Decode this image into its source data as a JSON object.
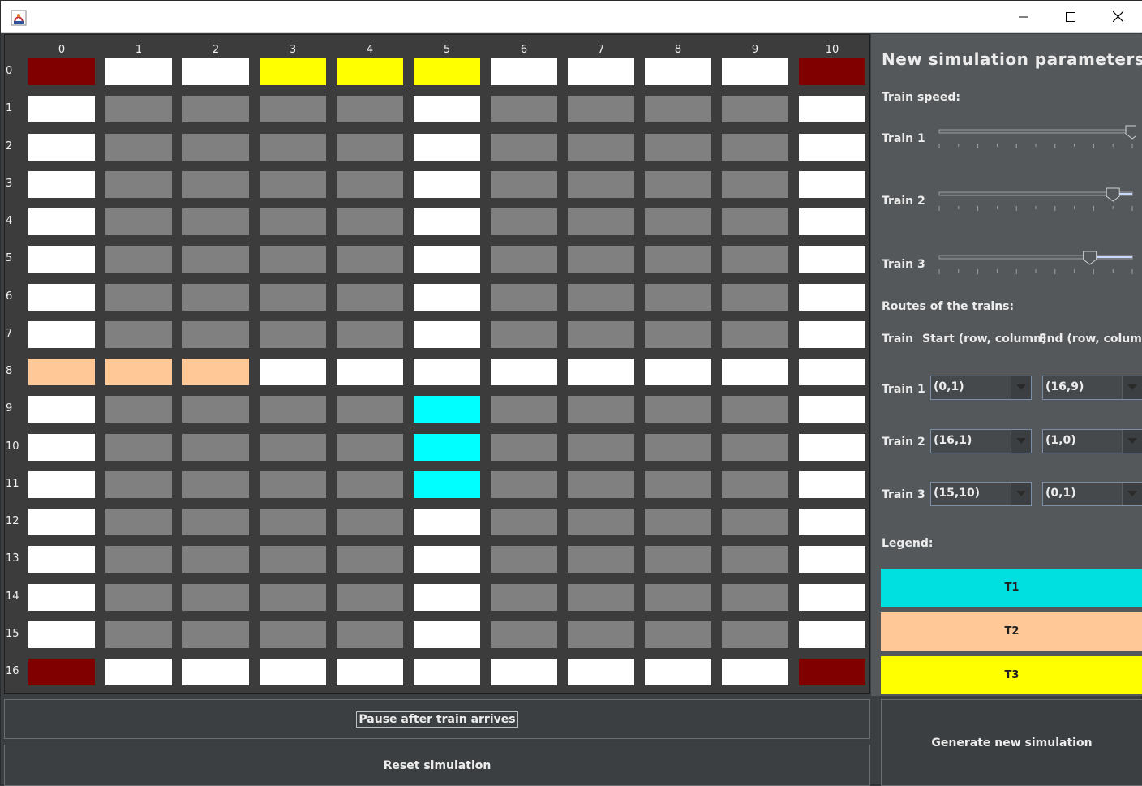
{
  "window": {
    "title": "",
    "controls": [
      "minimize",
      "maximize",
      "close"
    ]
  },
  "grid": {
    "columns": [
      "0",
      "1",
      "2",
      "3",
      "4",
      "5",
      "6",
      "7",
      "8",
      "9",
      "10"
    ],
    "rows": [
      "0",
      "1",
      "2",
      "3",
      "4",
      "5",
      "6",
      "7",
      "8",
      "9",
      "10",
      "11",
      "12",
      "13",
      "14",
      "15",
      "16"
    ],
    "cell_states_legend": {
      "W": "track",
      "G": "empty",
      "R": "station",
      "Y": "train-3",
      "O": "train-2",
      "C": "train-1"
    },
    "cells": [
      "RWWYYYWWWWR",
      "WGGGGWGGGGW",
      "WGGGGWGGGGW",
      "WGGGGWGGGGW",
      "WGGGGWGGGGW",
      "WGGGGWGGGGW",
      "WGGGGWGGGGW",
      "WGGGGWGGGGW",
      "OOOWWWWWWWW",
      "WGGGGCGGGGW",
      "WGGGGCGGGGW",
      "WGGGGCGGGGW",
      "WGGGGWGGGGW",
      "WGGGGWGGGGW",
      "WGGGGWGGGGW",
      "WGGGGWGGGGW",
      "RWWWWWWWWWR"
    ],
    "colors": {
      "W": "#ffffff",
      "G": "#808080",
      "R": "#800000",
      "Y": "#ffff00",
      "O": "#ffc896",
      "C": "#00ffff"
    }
  },
  "side": {
    "title": "New simulation parameters",
    "speed_label": "Train speed:",
    "speeds": [
      {
        "label": "Train 1",
        "value": 1.0
      },
      {
        "label": "Train 2",
        "value": 0.9
      },
      {
        "label": "Train 3",
        "value": 0.78
      }
    ],
    "routes_label": "Routes of the trains:",
    "routes_header": {
      "train": "Train",
      "start": "Start (row, column)",
      "end": "End (row, column)"
    },
    "routes": [
      {
        "label": "Train 1",
        "start": "(0,1)",
        "end": "(16,9)"
      },
      {
        "label": "Train 2",
        "start": "(16,1)",
        "end": "(1,0)"
      },
      {
        "label": "Train 3",
        "start": "(15,10)",
        "end": "(0,1)"
      }
    ],
    "legend_label": "Legend:",
    "legend": [
      {
        "label": "T1",
        "color": "#00e0e0"
      },
      {
        "label": "T2",
        "color": "#ffc896"
      },
      {
        "label": "T3",
        "color": "#ffff00"
      }
    ]
  },
  "buttons": {
    "pause": "Pause after train arrives",
    "reset": "Reset simulation",
    "generate": "Generate new simulation"
  }
}
